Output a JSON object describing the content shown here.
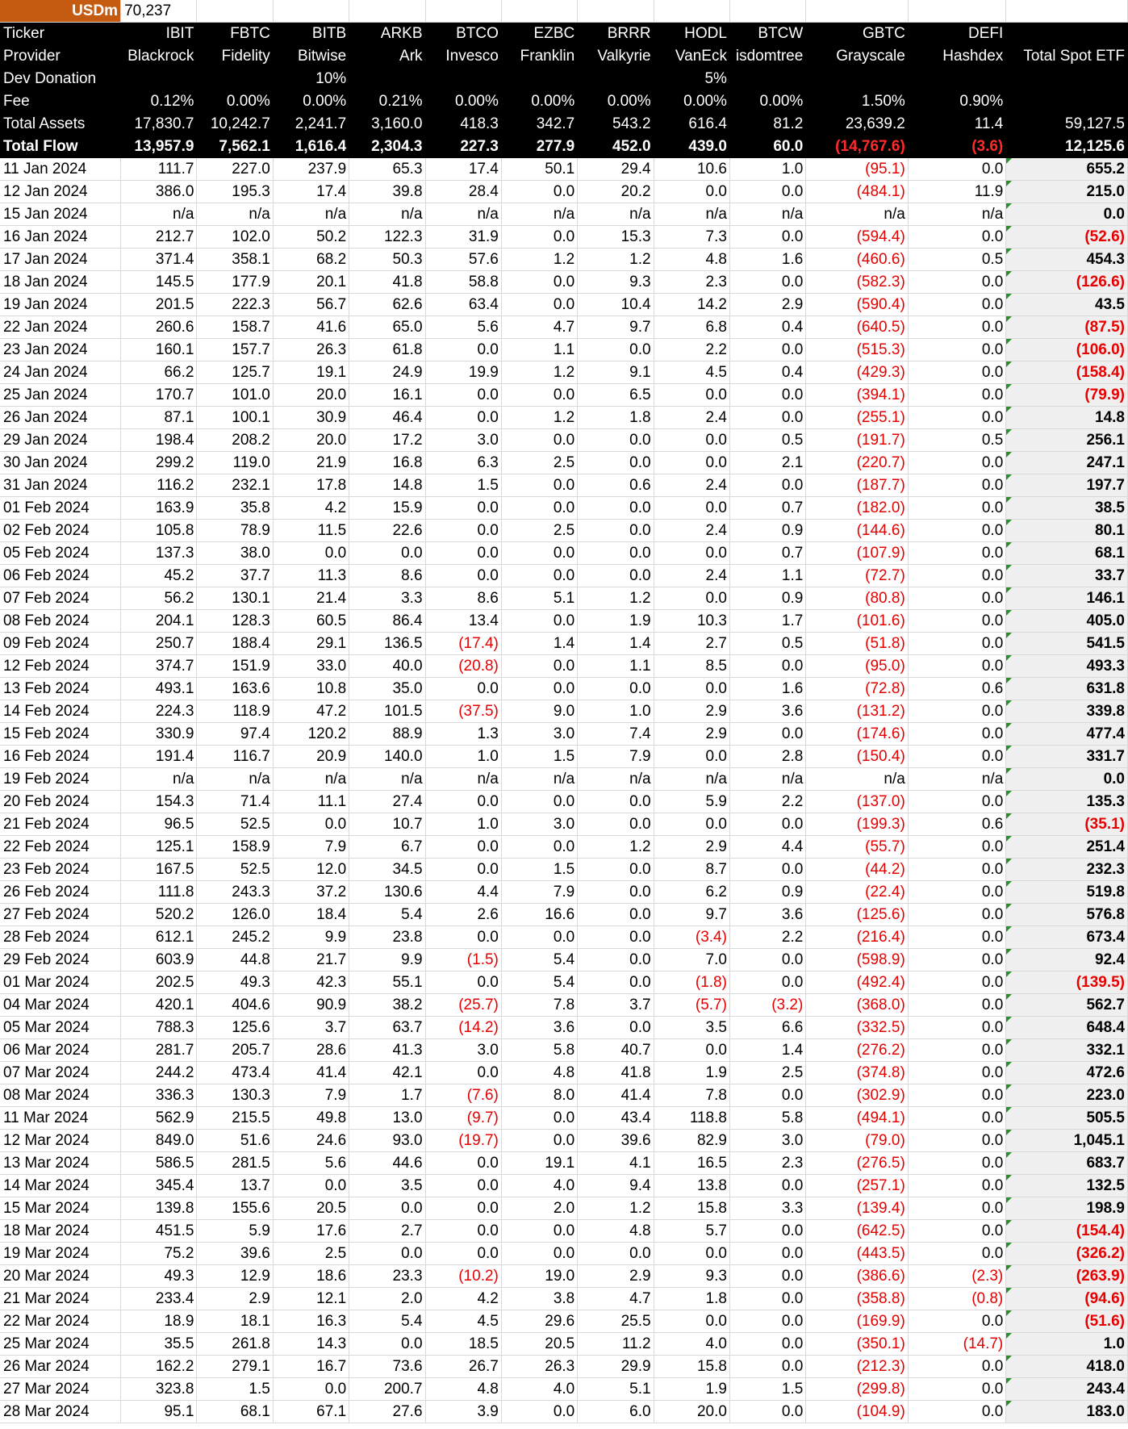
{
  "sheet": {
    "unit_label": "USDm",
    "unit_value": "70,237",
    "header_rows": [
      {
        "label": "Ticker",
        "values": [
          "IBIT",
          "FBTC",
          "BITB",
          "ARKB",
          "BTCO",
          "EZBC",
          "BRRR",
          "HODL",
          "BTCW",
          "GBTC",
          "DEFI",
          ""
        ]
      },
      {
        "label": "Provider",
        "values": [
          "Blackrock",
          "Fidelity",
          "Bitwise",
          "Ark",
          "Invesco",
          "Franklin",
          "Valkyrie",
          "VanEck",
          "isdomtree",
          "Grayscale",
          "Hashdex",
          "Total Spot ETF"
        ]
      },
      {
        "label": "Dev Donation",
        "values": [
          "",
          "",
          "10%",
          "",
          "",
          "",
          "",
          "5%",
          "",
          "",
          "",
          ""
        ]
      },
      {
        "label": "Fee",
        "values": [
          "0.12%",
          "0.00%",
          "0.00%",
          "0.21%",
          "0.00%",
          "0.00%",
          "0.00%",
          "0.00%",
          "0.00%",
          "1.50%",
          "0.90%",
          ""
        ]
      },
      {
        "label": "Total Assets",
        "values": [
          "17,830.7",
          "10,242.7",
          "2,241.7",
          "3,160.0",
          "418.3",
          "342.7",
          "543.2",
          "616.4",
          "81.2",
          "23,639.2",
          "11.4",
          "59,127.5"
        ]
      },
      {
        "label": "Total Flow",
        "values": [
          "13,957.9",
          "7,562.1",
          "1,616.4",
          "2,304.3",
          "227.3",
          "277.9",
          "452.0",
          "439.0",
          "60.0",
          "(14,767.6)",
          "(3.6)",
          "12,125.6"
        ]
      }
    ],
    "rows": [
      {
        "date": "11 Jan 2024",
        "values": [
          "111.7",
          "227.0",
          "237.9",
          "65.3",
          "17.4",
          "50.1",
          "29.4",
          "10.6",
          "1.0",
          "(95.1)",
          "0.0",
          "655.2"
        ]
      },
      {
        "date": "12 Jan 2024",
        "values": [
          "386.0",
          "195.3",
          "17.4",
          "39.8",
          "28.4",
          "0.0",
          "20.2",
          "0.0",
          "0.0",
          "(484.1)",
          "11.9",
          "215.0"
        ]
      },
      {
        "date": "15 Jan 2024",
        "values": [
          "n/a",
          "n/a",
          "n/a",
          "n/a",
          "n/a",
          "n/a",
          "n/a",
          "n/a",
          "n/a",
          "n/a",
          "n/a",
          "0.0"
        ]
      },
      {
        "date": "16 Jan 2024",
        "values": [
          "212.7",
          "102.0",
          "50.2",
          "122.3",
          "31.9",
          "0.0",
          "15.3",
          "7.3",
          "0.0",
          "(594.4)",
          "0.0",
          "(52.6)"
        ]
      },
      {
        "date": "17 Jan 2024",
        "values": [
          "371.4",
          "358.1",
          "68.2",
          "50.3",
          "57.6",
          "1.2",
          "1.2",
          "4.8",
          "1.6",
          "(460.6)",
          "0.5",
          "454.3"
        ]
      },
      {
        "date": "18 Jan 2024",
        "values": [
          "145.5",
          "177.9",
          "20.1",
          "41.8",
          "58.8",
          "0.0",
          "9.3",
          "2.3",
          "0.0",
          "(582.3)",
          "0.0",
          "(126.6)"
        ]
      },
      {
        "date": "19 Jan 2024",
        "values": [
          "201.5",
          "222.3",
          "56.7",
          "62.6",
          "63.4",
          "0.0",
          "10.4",
          "14.2",
          "2.9",
          "(590.4)",
          "0.0",
          "43.5"
        ]
      },
      {
        "date": "22 Jan 2024",
        "values": [
          "260.6",
          "158.7",
          "41.6",
          "65.0",
          "5.6",
          "4.7",
          "9.7",
          "6.8",
          "0.4",
          "(640.5)",
          "0.0",
          "(87.5)"
        ]
      },
      {
        "date": "23 Jan 2024",
        "values": [
          "160.1",
          "157.7",
          "26.3",
          "61.8",
          "0.0",
          "1.1",
          "0.0",
          "2.2",
          "0.0",
          "(515.3)",
          "0.0",
          "(106.0)"
        ]
      },
      {
        "date": "24 Jan 2024",
        "values": [
          "66.2",
          "125.7",
          "19.1",
          "24.9",
          "19.9",
          "1.2",
          "9.1",
          "4.5",
          "0.4",
          "(429.3)",
          "0.0",
          "(158.4)"
        ]
      },
      {
        "date": "25 Jan 2024",
        "values": [
          "170.7",
          "101.0",
          "20.0",
          "16.1",
          "0.0",
          "0.0",
          "6.5",
          "0.0",
          "0.0",
          "(394.1)",
          "0.0",
          "(79.9)"
        ]
      },
      {
        "date": "26 Jan 2024",
        "values": [
          "87.1",
          "100.1",
          "30.9",
          "46.4",
          "0.0",
          "1.2",
          "1.8",
          "2.4",
          "0.0",
          "(255.1)",
          "0.0",
          "14.8"
        ]
      },
      {
        "date": "29 Jan 2024",
        "values": [
          "198.4",
          "208.2",
          "20.0",
          "17.2",
          "3.0",
          "0.0",
          "0.0",
          "0.0",
          "0.5",
          "(191.7)",
          "0.5",
          "256.1"
        ]
      },
      {
        "date": "30 Jan 2024",
        "values": [
          "299.2",
          "119.0",
          "21.9",
          "16.8",
          "6.3",
          "2.5",
          "0.0",
          "0.0",
          "2.1",
          "(220.7)",
          "0.0",
          "247.1"
        ]
      },
      {
        "date": "31 Jan 2024",
        "values": [
          "116.2",
          "232.1",
          "17.8",
          "14.8",
          "1.5",
          "0.0",
          "0.6",
          "2.4",
          "0.0",
          "(187.7)",
          "0.0",
          "197.7"
        ]
      },
      {
        "date": "01 Feb 2024",
        "values": [
          "163.9",
          "35.8",
          "4.2",
          "15.9",
          "0.0",
          "0.0",
          "0.0",
          "0.0",
          "0.7",
          "(182.0)",
          "0.0",
          "38.5"
        ]
      },
      {
        "date": "02 Feb 2024",
        "values": [
          "105.8",
          "78.9",
          "11.5",
          "22.6",
          "0.0",
          "2.5",
          "0.0",
          "2.4",
          "0.9",
          "(144.6)",
          "0.0",
          "80.1"
        ]
      },
      {
        "date": "05 Feb 2024",
        "values": [
          "137.3",
          "38.0",
          "0.0",
          "0.0",
          "0.0",
          "0.0",
          "0.0",
          "0.0",
          "0.7",
          "(107.9)",
          "0.0",
          "68.1"
        ]
      },
      {
        "date": "06 Feb 2024",
        "values": [
          "45.2",
          "37.7",
          "11.3",
          "8.6",
          "0.0",
          "0.0",
          "0.0",
          "2.4",
          "1.1",
          "(72.7)",
          "0.0",
          "33.7"
        ]
      },
      {
        "date": "07 Feb 2024",
        "values": [
          "56.2",
          "130.1",
          "21.4",
          "3.3",
          "8.6",
          "5.1",
          "1.2",
          "0.0",
          "0.9",
          "(80.8)",
          "0.0",
          "146.1"
        ]
      },
      {
        "date": "08 Feb 2024",
        "values": [
          "204.1",
          "128.3",
          "60.5",
          "86.4",
          "13.4",
          "0.0",
          "1.9",
          "10.3",
          "1.7",
          "(101.6)",
          "0.0",
          "405.0"
        ]
      },
      {
        "date": "09 Feb 2024",
        "values": [
          "250.7",
          "188.4",
          "29.1",
          "136.5",
          "(17.4)",
          "1.4",
          "1.4",
          "2.7",
          "0.5",
          "(51.8)",
          "0.0",
          "541.5"
        ]
      },
      {
        "date": "12 Feb 2024",
        "values": [
          "374.7",
          "151.9",
          "33.0",
          "40.0",
          "(20.8)",
          "0.0",
          "1.1",
          "8.5",
          "0.0",
          "(95.0)",
          "0.0",
          "493.3"
        ]
      },
      {
        "date": "13 Feb 2024",
        "values": [
          "493.1",
          "163.6",
          "10.8",
          "35.0",
          "0.0",
          "0.0",
          "0.0",
          "0.0",
          "1.6",
          "(72.8)",
          "0.6",
          "631.8"
        ]
      },
      {
        "date": "14 Feb 2024",
        "values": [
          "224.3",
          "118.9",
          "47.2",
          "101.5",
          "(37.5)",
          "9.0",
          "1.0",
          "2.9",
          "3.6",
          "(131.2)",
          "0.0",
          "339.8"
        ]
      },
      {
        "date": "15 Feb 2024",
        "values": [
          "330.9",
          "97.4",
          "120.2",
          "88.9",
          "1.3",
          "3.0",
          "7.4",
          "2.9",
          "0.0",
          "(174.6)",
          "0.0",
          "477.4"
        ]
      },
      {
        "date": "16 Feb 2024",
        "values": [
          "191.4",
          "116.7",
          "20.9",
          "140.0",
          "1.0",
          "1.5",
          "7.9",
          "0.0",
          "2.8",
          "(150.4)",
          "0.0",
          "331.7"
        ]
      },
      {
        "date": "19 Feb 2024",
        "values": [
          "n/a",
          "n/a",
          "n/a",
          "n/a",
          "n/a",
          "n/a",
          "n/a",
          "n/a",
          "n/a",
          "n/a",
          "n/a",
          "0.0"
        ]
      },
      {
        "date": "20 Feb 2024",
        "values": [
          "154.3",
          "71.4",
          "11.1",
          "27.4",
          "0.0",
          "0.0",
          "0.0",
          "5.9",
          "2.2",
          "(137.0)",
          "0.0",
          "135.3"
        ]
      },
      {
        "date": "21 Feb 2024",
        "values": [
          "96.5",
          "52.5",
          "0.0",
          "10.7",
          "1.0",
          "3.0",
          "0.0",
          "0.0",
          "0.0",
          "(199.3)",
          "0.6",
          "(35.1)"
        ]
      },
      {
        "date": "22 Feb 2024",
        "values": [
          "125.1",
          "158.9",
          "7.9",
          "6.7",
          "0.0",
          "0.0",
          "1.2",
          "2.9",
          "4.4",
          "(55.7)",
          "0.0",
          "251.4"
        ]
      },
      {
        "date": "23 Feb 2024",
        "values": [
          "167.5",
          "52.5",
          "12.0",
          "34.5",
          "0.0",
          "1.5",
          "0.0",
          "8.7",
          "0.0",
          "(44.2)",
          "0.0",
          "232.3"
        ]
      },
      {
        "date": "26 Feb 2024",
        "values": [
          "111.8",
          "243.3",
          "37.2",
          "130.6",
          "4.4",
          "7.9",
          "0.0",
          "6.2",
          "0.9",
          "(22.4)",
          "0.0",
          "519.8"
        ]
      },
      {
        "date": "27 Feb 2024",
        "values": [
          "520.2",
          "126.0",
          "18.4",
          "5.4",
          "2.6",
          "16.6",
          "0.0",
          "9.7",
          "3.6",
          "(125.6)",
          "0.0",
          "576.8"
        ]
      },
      {
        "date": "28 Feb 2024",
        "values": [
          "612.1",
          "245.2",
          "9.9",
          "23.8",
          "0.0",
          "0.0",
          "0.0",
          "(3.4)",
          "2.2",
          "(216.4)",
          "0.0",
          "673.4"
        ]
      },
      {
        "date": "29 Feb 2024",
        "values": [
          "603.9",
          "44.8",
          "21.7",
          "9.9",
          "(1.5)",
          "5.4",
          "0.0",
          "7.0",
          "0.0",
          "(598.9)",
          "0.0",
          "92.4"
        ]
      },
      {
        "date": "01 Mar 2024",
        "values": [
          "202.5",
          "49.3",
          "42.3",
          "55.1",
          "0.0",
          "5.4",
          "0.0",
          "(1.8)",
          "0.0",
          "(492.4)",
          "0.0",
          "(139.5)"
        ]
      },
      {
        "date": "04 Mar 2024",
        "values": [
          "420.1",
          "404.6",
          "90.9",
          "38.2",
          "(25.7)",
          "7.8",
          "3.7",
          "(5.7)",
          "(3.2)",
          "(368.0)",
          "0.0",
          "562.7"
        ]
      },
      {
        "date": "05 Mar 2024",
        "values": [
          "788.3",
          "125.6",
          "3.7",
          "63.7",
          "(14.2)",
          "3.6",
          "0.0",
          "3.5",
          "6.6",
          "(332.5)",
          "0.0",
          "648.4"
        ]
      },
      {
        "date": "06 Mar 2024",
        "values": [
          "281.7",
          "205.7",
          "28.6",
          "41.3",
          "3.0",
          "5.8",
          "40.7",
          "0.0",
          "1.4",
          "(276.2)",
          "0.0",
          "332.1"
        ]
      },
      {
        "date": "07 Mar 2024",
        "values": [
          "244.2",
          "473.4",
          "41.4",
          "42.1",
          "0.0",
          "4.8",
          "41.8",
          "1.9",
          "2.5",
          "(374.8)",
          "0.0",
          "472.6"
        ]
      },
      {
        "date": "08 Mar 2024",
        "values": [
          "336.3",
          "130.3",
          "7.9",
          "1.7",
          "(7.6)",
          "8.0",
          "41.4",
          "7.8",
          "0.0",
          "(302.9)",
          "0.0",
          "223.0"
        ]
      },
      {
        "date": "11 Mar 2024",
        "values": [
          "562.9",
          "215.5",
          "49.8",
          "13.0",
          "(9.7)",
          "0.0",
          "43.4",
          "118.8",
          "5.8",
          "(494.1)",
          "0.0",
          "505.5"
        ]
      },
      {
        "date": "12 Mar 2024",
        "values": [
          "849.0",
          "51.6",
          "24.6",
          "93.0",
          "(19.7)",
          "0.0",
          "39.6",
          "82.9",
          "3.0",
          "(79.0)",
          "0.0",
          "1,045.1"
        ]
      },
      {
        "date": "13 Mar 2024",
        "values": [
          "586.5",
          "281.5",
          "5.6",
          "44.6",
          "0.0",
          "19.1",
          "4.1",
          "16.5",
          "2.3",
          "(276.5)",
          "0.0",
          "683.7"
        ]
      },
      {
        "date": "14 Mar 2024",
        "values": [
          "345.4",
          "13.7",
          "0.0",
          "3.5",
          "0.0",
          "4.0",
          "9.4",
          "13.8",
          "0.0",
          "(257.1)",
          "0.0",
          "132.5"
        ]
      },
      {
        "date": "15 Mar 2024",
        "values": [
          "139.8",
          "155.6",
          "20.5",
          "0.0",
          "0.0",
          "2.0",
          "1.2",
          "15.8",
          "3.3",
          "(139.4)",
          "0.0",
          "198.9"
        ]
      },
      {
        "date": "18 Mar 2024",
        "values": [
          "451.5",
          "5.9",
          "17.6",
          "2.7",
          "0.0",
          "0.0",
          "4.8",
          "5.7",
          "0.0",
          "(642.5)",
          "0.0",
          "(154.4)"
        ]
      },
      {
        "date": "19 Mar 2024",
        "values": [
          "75.2",
          "39.6",
          "2.5",
          "0.0",
          "0.0",
          "0.0",
          "0.0",
          "0.0",
          "0.0",
          "(443.5)",
          "0.0",
          "(326.2)"
        ]
      },
      {
        "date": "20 Mar 2024",
        "values": [
          "49.3",
          "12.9",
          "18.6",
          "23.3",
          "(10.2)",
          "19.0",
          "2.9",
          "9.3",
          "0.0",
          "(386.6)",
          "(2.3)",
          "(263.9)"
        ]
      },
      {
        "date": "21 Mar 2024",
        "values": [
          "233.4",
          "2.9",
          "12.1",
          "2.0",
          "4.2",
          "3.8",
          "4.7",
          "1.8",
          "0.0",
          "(358.8)",
          "(0.8)",
          "(94.6)"
        ]
      },
      {
        "date": "22 Mar 2024",
        "values": [
          "18.9",
          "18.1",
          "16.3",
          "5.4",
          "4.5",
          "29.6",
          "25.5",
          "0.0",
          "0.0",
          "(169.9)",
          "0.0",
          "(51.6)"
        ]
      },
      {
        "date": "25 Mar 2024",
        "values": [
          "35.5",
          "261.8",
          "14.3",
          "0.0",
          "18.5",
          "20.5",
          "11.2",
          "4.0",
          "0.0",
          "(350.1)",
          "(14.7)",
          "1.0"
        ]
      },
      {
        "date": "26 Mar 2024",
        "values": [
          "162.2",
          "279.1",
          "16.7",
          "73.6",
          "26.7",
          "26.3",
          "29.9",
          "15.8",
          "0.0",
          "(212.3)",
          "0.0",
          "418.0"
        ]
      },
      {
        "date": "27 Mar 2024",
        "values": [
          "323.8",
          "1.5",
          "0.0",
          "200.7",
          "4.8",
          "4.0",
          "5.1",
          "1.9",
          "1.5",
          "(299.8)",
          "0.0",
          "243.4"
        ]
      },
      {
        "date": "28 Mar 2024",
        "values": [
          "95.1",
          "68.1",
          "67.1",
          "27.6",
          "3.9",
          "0.0",
          "6.0",
          "20.0",
          "0.0",
          "(104.9)",
          "0.0",
          "183.0"
        ]
      }
    ],
    "colors": {
      "header_bg": "#000000",
      "header_text": "#ffffff",
      "negative": "#e60000",
      "unit_label_bg": "#c55a11",
      "total_col_bg": "#efefef",
      "total_flag": "#2e8b2e"
    }
  }
}
